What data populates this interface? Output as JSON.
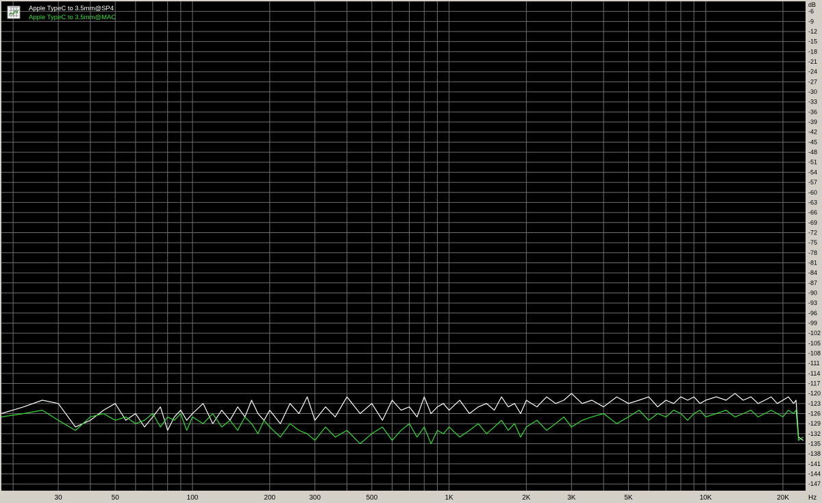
{
  "colors": {
    "plot_background": "#000000",
    "grid": "#6e6e6e",
    "frame_background": "#d4d0c8",
    "series_sp4": "#ffffff",
    "series_mac": "#33dd33"
  },
  "legend": {
    "icon": "spectrum-icon",
    "placement": "top-left"
  },
  "chart_data": {
    "type": "line",
    "xscale": "log",
    "xlim": [
      18,
      24500
    ],
    "ylim": [
      -149,
      -3
    ],
    "x_unit": "Hz",
    "y_unit": "dB",
    "grid": true,
    "x_ticks": [
      20,
      30,
      40,
      50,
      60,
      70,
      80,
      90,
      100,
      200,
      300,
      400,
      500,
      600,
      700,
      800,
      900,
      1000,
      2000,
      3000,
      4000,
      5000,
      6000,
      7000,
      8000,
      9000,
      10000,
      20000
    ],
    "x_tick_labels": [
      {
        "value": 30,
        "label": "30"
      },
      {
        "value": 50,
        "label": "50"
      },
      {
        "value": 100,
        "label": "100"
      },
      {
        "value": 200,
        "label": "200"
      },
      {
        "value": 300,
        "label": "300"
      },
      {
        "value": 500,
        "label": "500"
      },
      {
        "value": 1000,
        "label": "1K"
      },
      {
        "value": 2000,
        "label": "2K"
      },
      {
        "value": 3000,
        "label": "3K"
      },
      {
        "value": 5000,
        "label": "5K"
      },
      {
        "value": 10000,
        "label": "10K"
      },
      {
        "value": 20000,
        "label": "20K"
      }
    ],
    "y_ticks": [
      -6,
      -9,
      -12,
      -15,
      -18,
      -21,
      -24,
      -27,
      -30,
      -33,
      -36,
      -39,
      -42,
      -45,
      -48,
      -51,
      -54,
      -57,
      -60,
      -63,
      -66,
      -69,
      -72,
      -75,
      -78,
      -81,
      -84,
      -87,
      -90,
      -93,
      -96,
      -99,
      -102,
      -105,
      -108,
      -111,
      -114,
      -117,
      -120,
      -123,
      -126,
      -129,
      -132,
      -135,
      -138,
      -141,
      -144,
      -147
    ],
    "series": [
      {
        "name": "Apple TypeC to 3.5mm@SP4",
        "color": "#ffffff",
        "x": [
          18,
          22,
          26,
          30,
          35,
          40,
          45,
          50,
          55,
          60,
          65,
          70,
          75,
          80,
          85,
          90,
          95,
          100,
          110,
          120,
          130,
          140,
          150,
          160,
          170,
          180,
          190,
          200,
          220,
          240,
          260,
          280,
          300,
          330,
          360,
          400,
          450,
          500,
          550,
          600,
          650,
          700,
          750,
          800,
          850,
          900,
          950,
          1000,
          1100,
          1200,
          1300,
          1400,
          1500,
          1600,
          1700,
          1800,
          1900,
          2000,
          2200,
          2400,
          2600,
          2800,
          3000,
          3300,
          3600,
          4000,
          4500,
          5000,
          5500,
          6000,
          6500,
          7000,
          7500,
          8000,
          8500,
          9000,
          9500,
          10000,
          11000,
          12000,
          13000,
          14000,
          15000,
          16000,
          17000,
          18000,
          19000,
          20000,
          21000,
          22000,
          22500,
          23000,
          24000
        ],
        "y": [
          -126,
          -124,
          -122,
          -123,
          -130,
          -128,
          -125,
          -123,
          -128,
          -126,
          -130,
          -127,
          -124,
          -131,
          -127,
          -125,
          -128,
          -126,
          -123,
          -129,
          -125,
          -128,
          -124,
          -127,
          -122,
          -126,
          -128,
          -125,
          -129,
          -123,
          -126,
          -121,
          -128,
          -124,
          -127,
          -121,
          -126,
          -123,
          -128,
          -122,
          -125,
          -124,
          -127,
          -121,
          -126,
          -124,
          -123,
          -125,
          -122,
          -126,
          -124,
          -123,
          -125,
          -121,
          -124,
          -123,
          -126,
          -122,
          -124,
          -121,
          -123,
          -122,
          -120,
          -123,
          -122,
          -124,
          -121,
          -123,
          -122,
          -121,
          -124,
          -122,
          -123,
          -121,
          -122,
          -121,
          -123,
          -122,
          -121,
          -122,
          -120,
          -122,
          -121,
          -123,
          -122,
          -121,
          -123,
          -122,
          -121,
          -123,
          -122,
          -133,
          -134
        ]
      },
      {
        "name": "Apple TypeC to 3.5mm@MAC",
        "color": "#33dd33",
        "x": [
          18,
          22,
          26,
          30,
          35,
          40,
          45,
          50,
          55,
          60,
          65,
          70,
          75,
          80,
          85,
          90,
          95,
          100,
          110,
          120,
          130,
          140,
          150,
          160,
          170,
          180,
          190,
          200,
          220,
          240,
          260,
          280,
          300,
          330,
          360,
          400,
          450,
          500,
          550,
          600,
          650,
          700,
          750,
          800,
          850,
          900,
          950,
          1000,
          1100,
          1200,
          1300,
          1400,
          1500,
          1600,
          1700,
          1800,
          1900,
          2000,
          2200,
          2400,
          2600,
          2800,
          3000,
          3300,
          3600,
          4000,
          4500,
          5000,
          5500,
          6000,
          6500,
          7000,
          7500,
          8000,
          8500,
          9000,
          9500,
          10000,
          11000,
          12000,
          13000,
          14000,
          15000,
          16000,
          17000,
          18000,
          19000,
          20000,
          21000,
          22000,
          22500,
          23000,
          24000
        ],
        "y": [
          -127,
          -126,
          -125,
          -128,
          -131,
          -127,
          -126,
          -128,
          -127,
          -129,
          -128,
          -126,
          -130,
          -127,
          -128,
          -126,
          -131,
          -127,
          -129,
          -126,
          -130,
          -128,
          -131,
          -127,
          -129,
          -132,
          -128,
          -130,
          -133,
          -129,
          -131,
          -132,
          -134,
          -130,
          -133,
          -131,
          -135,
          -132,
          -130,
          -134,
          -131,
          -129,
          -133,
          -130,
          -135,
          -131,
          -132,
          -130,
          -133,
          -131,
          -129,
          -132,
          -130,
          -128,
          -131,
          -129,
          -133,
          -130,
          -128,
          -131,
          -129,
          -127,
          -130,
          -128,
          -127,
          -126,
          -129,
          -127,
          -125,
          -128,
          -126,
          -127,
          -125,
          -126,
          -128,
          -126,
          -125,
          -127,
          -126,
          -125,
          -127,
          -126,
          -125,
          -127,
          -126,
          -125,
          -126,
          -127,
          -125,
          -126,
          -125,
          -134,
          -133
        ]
      }
    ]
  }
}
